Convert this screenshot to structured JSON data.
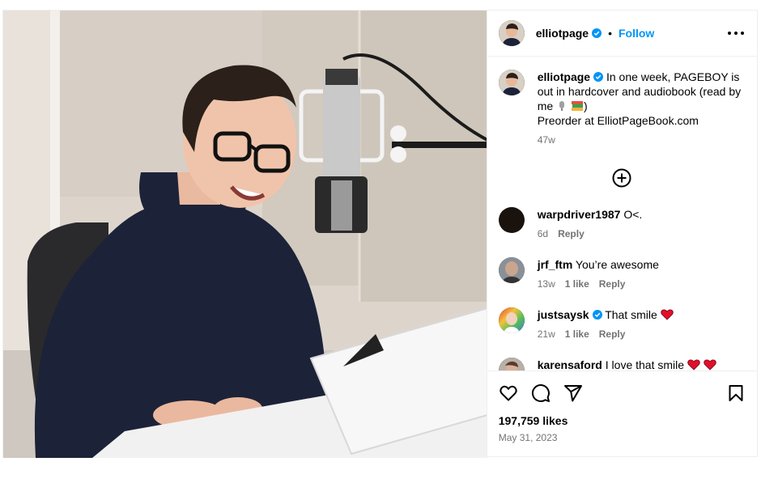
{
  "post": {
    "username": "elliotpage",
    "follow_label": "Follow",
    "dot": "•",
    "caption_user": "elliotpage",
    "caption_text": "In one week, PAGEBOY is out in hardcover and audiobook (read by me",
    "caption_close": ")",
    "caption_line2": "Preorder at ElliotPageBook.com",
    "caption_time": "47w",
    "likes": "197,759 likes",
    "date": "May 31, 2023",
    "accent": "#0095f6",
    "icons": [
      "more-horizontal-icon",
      "add-circle-icon",
      "heart-icon",
      "comment-icon",
      "share-icon",
      "bookmark-icon",
      "verified-icon"
    ]
  },
  "comments": [
    {
      "user": "warpdriver1987",
      "verified": false,
      "text": "O<.",
      "time": "6d",
      "likes": "",
      "reply": "Reply"
    },
    {
      "user": "jrf_ftm",
      "verified": false,
      "text": "You’re awesome",
      "time": "13w",
      "likes": "1 like",
      "reply": "Reply"
    },
    {
      "user": "justsaysk",
      "verified": true,
      "text": "That smile",
      "time": "21w",
      "likes": "1 like",
      "reply": "Reply"
    },
    {
      "user": "karensaford",
      "verified": false,
      "text": "I love that smile",
      "time": "",
      "likes": "",
      "reply": ""
    }
  ]
}
